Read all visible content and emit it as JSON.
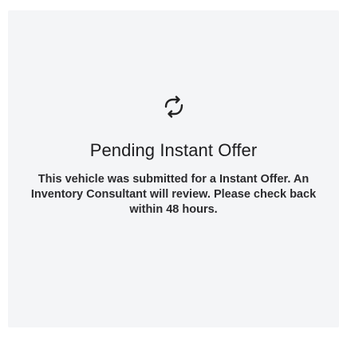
{
  "status_card": {
    "icon": "refresh-icon",
    "title": "Pending Instant Offer",
    "message": "This vehicle was submitted for a Instant Offer. An Inventory Consultant will review. Please check back within 48 hours."
  },
  "colors": {
    "panel_background": "#f4f5f7",
    "title_text": "#1d1d1f",
    "body_text": "#2b2b2e"
  }
}
